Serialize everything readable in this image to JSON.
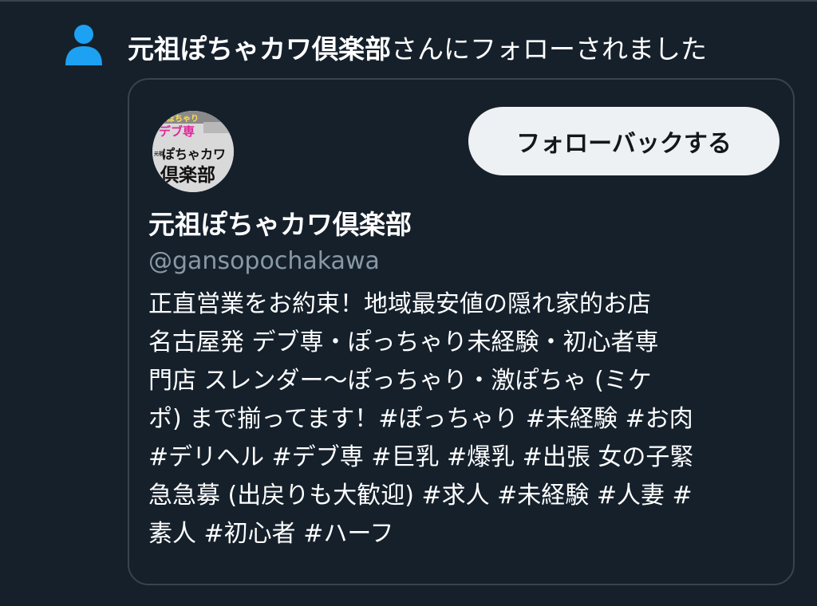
{
  "notification": {
    "account_name": "元祖ぽちゃカワ倶楽部",
    "message_suffix": "さんにフォローされました"
  },
  "card": {
    "follow_back_label": "フォローバックする",
    "display_name": "元祖ぽちゃカワ倶楽部",
    "handle": "@gansopochakawa",
    "bio_lines": [
      "正直営業をお約束！地域最安値の隠れ家的お店",
      "名古屋発 デブ専・ぽっちゃり未経験・初心者専",
      "門店 スレンダー〜ぽっちゃり・激ぽちゃ (ミケ",
      "ポ) まで揃ってます！#ぽっちゃり #未経験 #お肉",
      "#デリヘル #デブ専 #巨乳 #爆乳 #出張 女の子緊",
      "急急募 (出戻りも大歓迎) #求人 #未経験 #人妻 #",
      "素人 #初心者 #ハーフ"
    ],
    "avatar_logo": {
      "top_text": "ぽちゃり",
      "pink_text": "デブ専",
      "side_text": "元祖",
      "middle_text": "ぽちゃカワ",
      "bottom_text": "倶楽部"
    }
  },
  "colors": {
    "background": "#15202b",
    "border": "#38444d",
    "secondary_text": "#8899a6",
    "follow_icon": "#1da1f2",
    "button_bg": "#eef1f3"
  },
  "icons": {
    "follow": "person-icon"
  }
}
